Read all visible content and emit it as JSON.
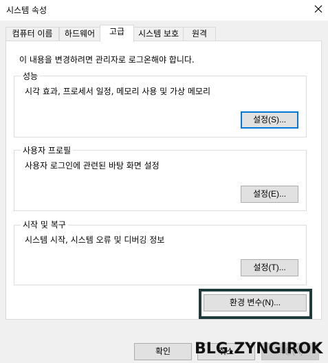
{
  "window": {
    "title": "시스템 속성"
  },
  "tabs": [
    {
      "label": "컴퓨터 이름"
    },
    {
      "label": "하드웨어"
    },
    {
      "label": "고급"
    },
    {
      "label": "시스템 보호"
    },
    {
      "label": "원격"
    }
  ],
  "intro": "이 내용을 변경하려면 관리자로 로그온해야 합니다.",
  "performance": {
    "title": "성능",
    "description": "시각 효과, 프로세서 일정, 메모리 사용 및 가상 메모리",
    "button": "설정(S)..."
  },
  "user_profile": {
    "title": "사용자 프로필",
    "description": "사용자 로그인에 관련된 바탕 화면 설정",
    "button": "설정(E)..."
  },
  "startup_recovery": {
    "title": "시작 및 복구",
    "description": "시스템 시작, 시스템 오류 및 디버깅 정보",
    "button": "설정(T)..."
  },
  "env_button": "환경 변수(N)...",
  "footer": {
    "ok": "확인",
    "cancel": "취소",
    "apply": "적용(A)"
  },
  "watermark": "BLG.ZYNGIROK",
  "colors": {
    "focus": "#0078d7",
    "highlight_frame": "#1f3a3d"
  }
}
